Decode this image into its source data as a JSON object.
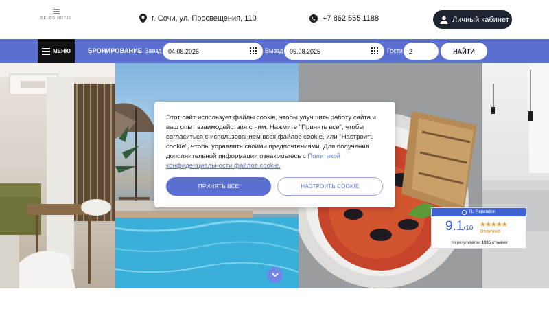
{
  "header": {
    "logo_text": "DELOS HOTEL",
    "address": "г. Сочи, ул. Просвещения, 110",
    "phone": "+7 862 555 1188",
    "cabinet_label": "Личный кабинет"
  },
  "booking": {
    "menu_label": "МЕНЮ",
    "title": "БРОНИРОВАНИЕ",
    "checkin_label": "Заезд",
    "checkin_value": "04.08.2025",
    "checkout_label": "Выезд",
    "checkout_value": "05.08.2025",
    "guests_label": "Гости",
    "guests_value": "2",
    "search_label": "НАЙТИ"
  },
  "cookie": {
    "text": "Этот сайт использует файлы cookie, чтобы улучшить работу сайта и ваш опыт взаимодействия с ним. Нажмите \"Принять все\", чтобы согласиться с использованием всех файлов cookie, или \"Настроить cookie\", чтобы управлять своими предпочтениями. Для получения дополнительной информации ознакомьтесь с ",
    "link_text": "Политикой конфиденциальности файлов cookie.",
    "accept_label": "ПРИНЯТЬ ВСЕ",
    "settings_label": "НАСТРОИТЬ COOKIE"
  },
  "rating": {
    "provider": "TL: Reputation",
    "score": "9.1",
    "scale": "/10",
    "stars": "★★★★★",
    "word": "Отлично",
    "footer_prefix": "по результатам",
    "reviews_count": "1085",
    "footer_suffix": "отзывов"
  },
  "slider": {
    "dots": 5,
    "active_index": 2
  },
  "colors": {
    "accent": "#5a6fd0",
    "dark": "#1f2433",
    "rating_blue": "#3f63d4",
    "star": "#f2a33a"
  }
}
